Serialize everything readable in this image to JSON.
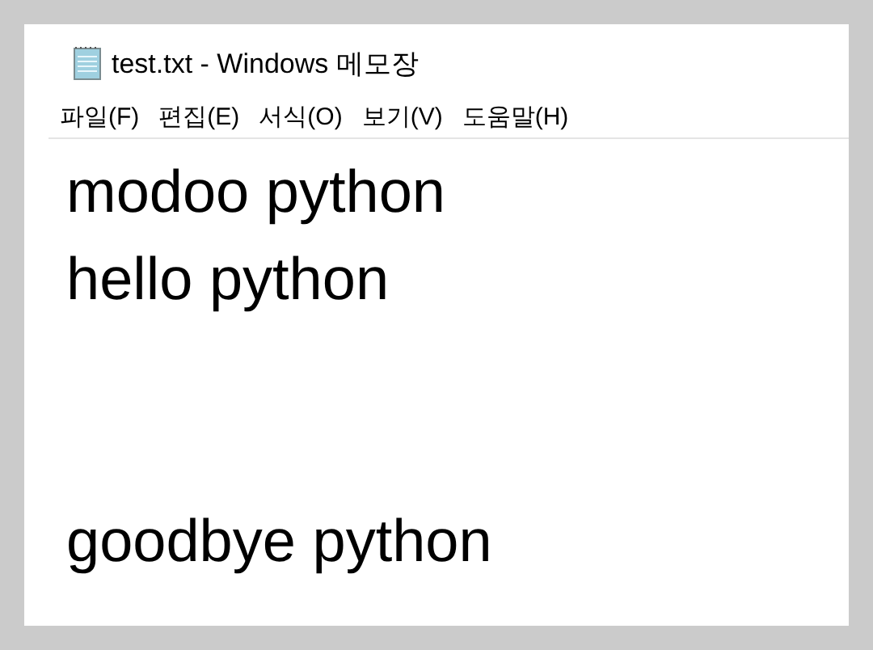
{
  "window": {
    "title": "test.txt - Windows 메모장"
  },
  "menu": [
    {
      "label": "파일(F)"
    },
    {
      "label": "편집(E)"
    },
    {
      "label": "서식(O)"
    },
    {
      "label": "보기(V)"
    },
    {
      "label": "도움말(H)"
    }
  ],
  "editor": {
    "blocks": [
      {
        "lines": [
          "modoo python",
          "hello python"
        ]
      },
      {
        "lines": [
          "goodbye python"
        ]
      }
    ]
  }
}
